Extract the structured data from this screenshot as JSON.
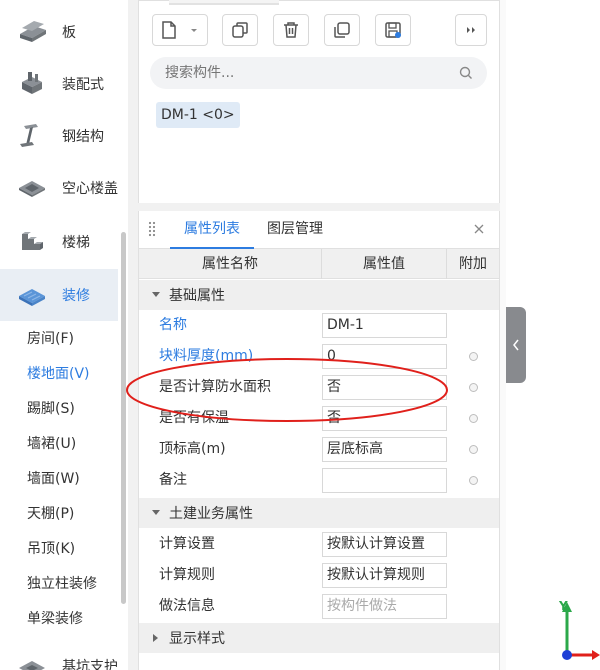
{
  "sidebar": {
    "categories": [
      {
        "label": "板",
        "icon": "slab-icon"
      },
      {
        "label": "装配式",
        "icon": "prefab-icon"
      },
      {
        "label": "钢结构",
        "icon": "steel-beam-icon"
      },
      {
        "label": "空心楼盖",
        "icon": "hollow-floor-icon"
      },
      {
        "label": "楼梯",
        "icon": "stairs-icon"
      },
      {
        "label": "装修",
        "icon": "decoration-icon",
        "active": true
      }
    ],
    "sub_items": [
      {
        "label": "房间(F)"
      },
      {
        "label": "楼地面(V)",
        "active": true
      },
      {
        "label": "踢脚(S)"
      },
      {
        "label": "墙裙(U)"
      },
      {
        "label": "墙面(W)"
      },
      {
        "label": "天棚(P)"
      },
      {
        "label": "吊顶(K)"
      },
      {
        "label": "独立柱装修"
      },
      {
        "label": "单梁装修"
      }
    ],
    "bottom_category": {
      "label": "基坑支护",
      "icon": "foundation-pit-icon"
    }
  },
  "component_panel": {
    "search_placeholder": "搜索构件...",
    "item": "DM-1 <0>"
  },
  "property_panel": {
    "tabs": [
      "属性列表",
      "图层管理"
    ],
    "columns": [
      "属性名称",
      "属性值",
      "附加"
    ],
    "groups": [
      {
        "label": "基础属性",
        "rows": [
          {
            "name": "名称",
            "value": "DM-1",
            "blue": true,
            "dot": false
          },
          {
            "name": "块料厚度(mm)",
            "value": "0",
            "blue": true,
            "dot": true
          },
          {
            "name": "是否计算防水面积",
            "value": "否",
            "blue": false,
            "dot": true
          },
          {
            "name": "是否有保温",
            "value": "否",
            "blue": false,
            "dot": true
          },
          {
            "name": "顶标高(m)",
            "value": "层底标高",
            "blue": false,
            "dot": true
          },
          {
            "name": "备注",
            "value": "",
            "blue": false,
            "dot": true
          }
        ]
      },
      {
        "label": "土建业务属性",
        "rows": [
          {
            "name": "计算设置",
            "value": "按默认计算设置",
            "blue": false,
            "dot": false
          },
          {
            "name": "计算规则",
            "value": "按默认计算规则",
            "blue": false,
            "dot": false
          },
          {
            "name": "做法信息",
            "value": "按构件做法",
            "blue": false,
            "dot": false,
            "placeholder": true
          }
        ]
      },
      {
        "label": "显示样式",
        "rows": []
      }
    ]
  },
  "axis": {
    "y_label": "Y"
  },
  "colors": {
    "accent": "#2d7ce0",
    "annotation": "#e0201b"
  }
}
